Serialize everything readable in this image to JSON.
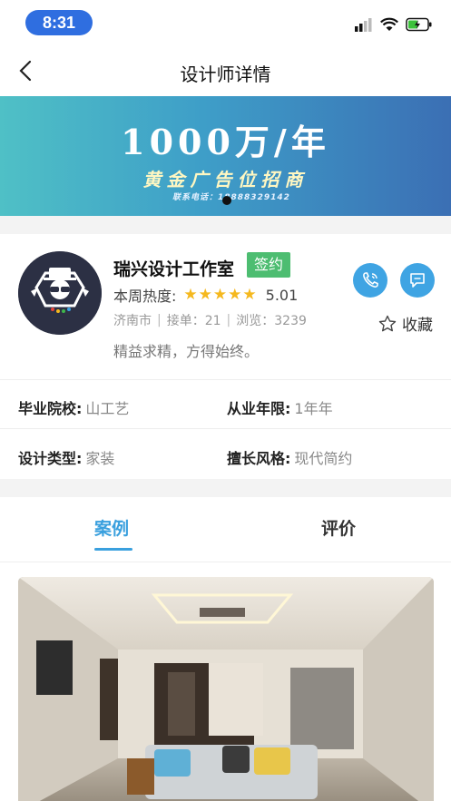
{
  "status_bar": {
    "time": "8:31"
  },
  "nav": {
    "title": "设计师详情"
  },
  "banner": {
    "headline": "1000万/年",
    "subline": "黄金广告位招商",
    "contact": "联系电话：18888329142"
  },
  "profile": {
    "name": "瑞兴设计工作室",
    "badge": "签约",
    "heat_label": "本周热度:",
    "rating": 5,
    "score": "5.01",
    "city": "济南市",
    "orders": "接单：21",
    "views": "浏览：3239",
    "motto": "精益求精，方得始终。",
    "favorite_label": "收藏"
  },
  "info": {
    "school_label": "毕业院校:",
    "school_value": "山工艺",
    "years_label": "从业年限:",
    "years_value": "1年年",
    "type_label": "设计类型:",
    "type_value": "家装",
    "style_label": "擅长风格:",
    "style_value": "现代简约"
  },
  "tabs": [
    {
      "label": "案例",
      "active": true
    },
    {
      "label": "评价",
      "active": false
    }
  ],
  "colors": {
    "accent": "#3aa0de",
    "badge_green": "#4dbd71",
    "star": "#f5b81e",
    "time_pill": "#2f6ee0"
  }
}
